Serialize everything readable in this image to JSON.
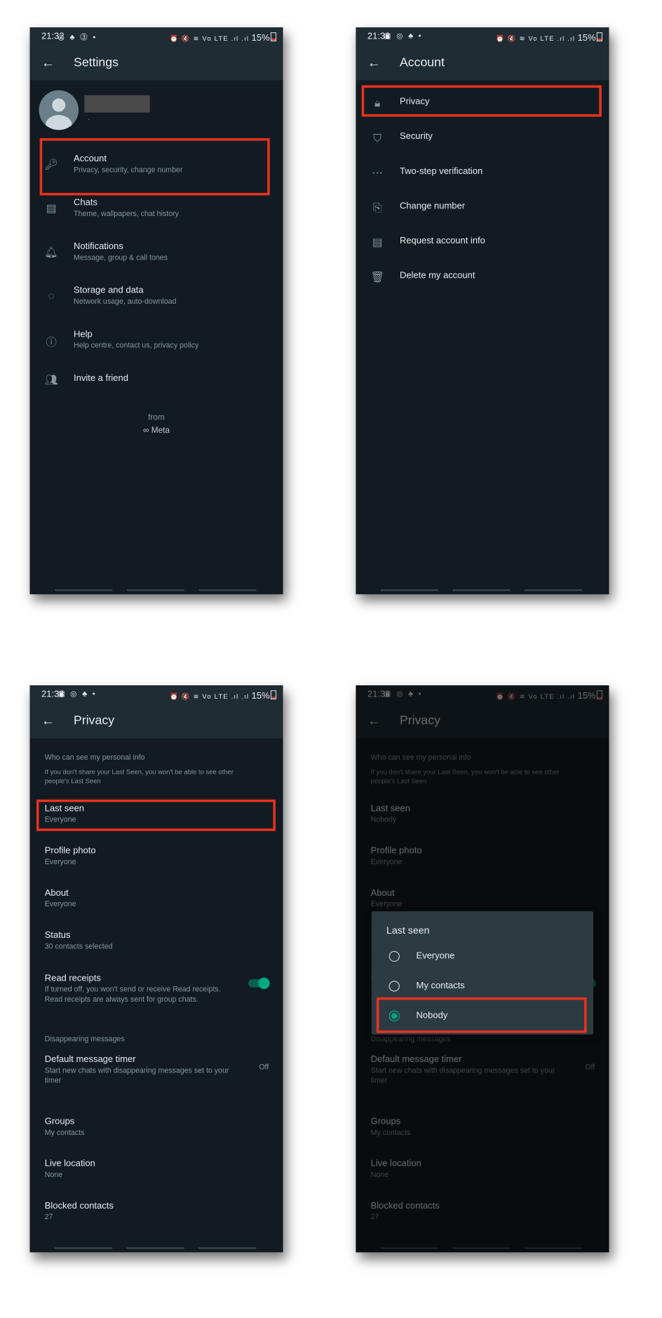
{
  "status_bars": [
    {
      "time": "21:32",
      "left_icons": "◎ ♣ ⓷ •",
      "right_icons": "⏰ 🔇 ≋ Vo LTE .ıl .ıl",
      "battery": "15%"
    },
    {
      "time": "21:33",
      "left_icons": "▣ ◎ ♣ •",
      "right_icons": "⏰ 🔇 ≋ Vo LTE .ıl .ıl",
      "battery": "15%"
    },
    {
      "time": "21:33",
      "left_icons": "▣ ◎ ♣ •",
      "right_icons": "⏰ 🔇 ≋ Vo LTE .ıl .ıl",
      "battery": "15%"
    },
    {
      "time": "21:33",
      "left_icons": "▣ ◎ ♣ •",
      "right_icons": "⏰ 🔇 ≋ Vo LTE .ıl .ıl",
      "battery": "15%"
    }
  ],
  "accent_color": "#00a884",
  "highlight_color": "#e8321f",
  "settings": {
    "title": "Settings",
    "profile": {
      "name_redacted": true,
      "subtitle": "·"
    },
    "items": [
      {
        "icon": "key-icon",
        "title": "Account",
        "subtitle": "Privacy, security, change number",
        "highlighted": true
      },
      {
        "icon": "chat-icon",
        "title": "Chats",
        "subtitle": "Theme, wallpapers, chat history"
      },
      {
        "icon": "bell-icon",
        "title": "Notifications",
        "subtitle": "Message, group & call tones"
      },
      {
        "icon": "storage-icon",
        "title": "Storage and data",
        "subtitle": "Network usage, auto-download"
      },
      {
        "icon": "help-icon",
        "title": "Help",
        "subtitle": "Help centre, contact us, privacy policy"
      },
      {
        "icon": "people-icon",
        "title": "Invite a friend"
      }
    ],
    "footer_from": "from",
    "footer_brand": "∞ Meta"
  },
  "account": {
    "title": "Account",
    "items": [
      {
        "icon": "lock-icon",
        "title": "Privacy",
        "highlighted": true
      },
      {
        "icon": "shield-icon",
        "title": "Security"
      },
      {
        "icon": "dots-icon",
        "title": "Two-step verification"
      },
      {
        "icon": "change-number-icon",
        "title": "Change number"
      },
      {
        "icon": "document-icon",
        "title": "Request account info"
      },
      {
        "icon": "trash-icon",
        "title": "Delete my account"
      }
    ]
  },
  "privacy": {
    "title": "Privacy",
    "section_personal": "Who can see my personal info",
    "section_desc_1": "If you don't share your Last Seen, you won't be able to see other",
    "section_desc_2": "people's Last Seen",
    "items": [
      {
        "title": "Last seen",
        "value": "Everyone",
        "highlighted": true
      },
      {
        "title": "Profile photo",
        "value": "Everyone"
      },
      {
        "title": "About",
        "value": "Everyone"
      },
      {
        "title": "Status",
        "value": "30 contacts selected"
      }
    ],
    "read_receipts": {
      "title": "Read receipts",
      "desc_1": "If turned off, you won't send or receive Read receipts.",
      "desc_2": "Read receipts are always sent for group chats.",
      "enabled": true
    },
    "section_disappearing": "Disappearing messages",
    "timer": {
      "title": "Default message timer",
      "desc_1": "Start new chats with disappearing messages set to your",
      "desc_2": "timer",
      "value": "Off"
    },
    "more_items": [
      {
        "title": "Groups",
        "value": "My contacts"
      },
      {
        "title": "Live location",
        "value": "None"
      },
      {
        "title": "Blocked contacts",
        "value": "27"
      }
    ]
  },
  "privacy_dialog": {
    "last_seen_value": "Nobody",
    "dialog_title": "Last seen",
    "options": [
      {
        "label": "Everyone",
        "selected": false
      },
      {
        "label": "My contacts",
        "selected": false
      },
      {
        "label": "Nobody",
        "selected": true,
        "highlighted": true
      }
    ]
  }
}
